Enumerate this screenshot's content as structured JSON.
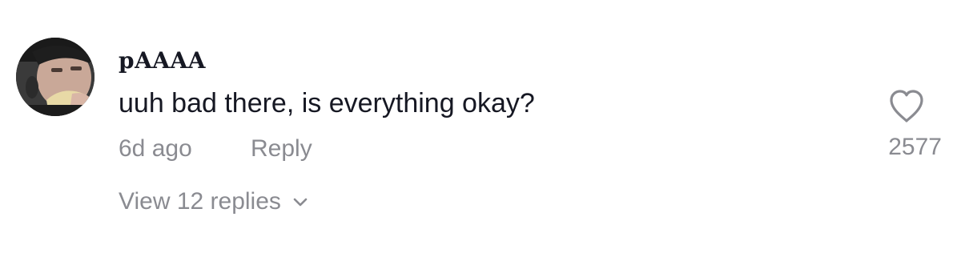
{
  "comment": {
    "username": "pAAAA",
    "text": "uuh bad there, is everything okay?",
    "time": "6d ago",
    "reply_label": "Reply",
    "view_replies_label": "View 12 replies",
    "like_count": "2577",
    "icons": {
      "avatar": "user-avatar",
      "like": "heart-icon",
      "expand": "chevron-down-icon"
    }
  },
  "colors": {
    "primary_text": "#161823",
    "secondary_text": "#8a8b91",
    "background": "#ffffff"
  }
}
